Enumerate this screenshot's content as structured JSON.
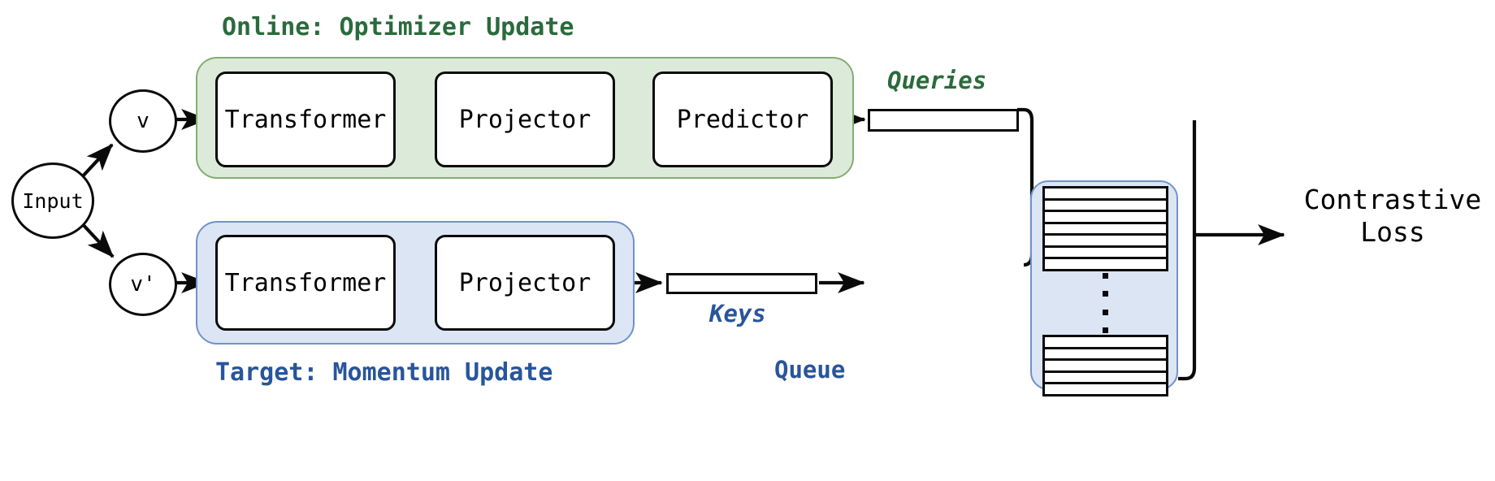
{
  "diagram": {
    "title_online": "Online: Optimizer Update",
    "title_target": "Target: Momentum Update",
    "label_queries": "Queries",
    "label_keys": "Keys",
    "label_queue": "Queue",
    "loss_line1": "Contrastive",
    "loss_line2": "Loss",
    "colors": {
      "online_fill": "#dceada",
      "online_stroke": "#84ad70",
      "online_text": "#2a6b3b",
      "target_fill": "#dce5f4",
      "target_stroke": "#7192c8",
      "target_text": "#28559b",
      "box_stroke": "#0a0a0a",
      "box_fill": "#ffffff",
      "background": "#ffffff"
    }
  },
  "nodes": {
    "input": "Input",
    "view_online": "v",
    "view_target": "v'"
  },
  "online_branch": {
    "modules": [
      {
        "label": "Transformer"
      },
      {
        "label": "Projector"
      },
      {
        "label": "Predictor"
      }
    ]
  },
  "target_branch": {
    "modules": [
      {
        "label": "Transformer"
      },
      {
        "label": "Projector"
      }
    ]
  },
  "queue": {
    "top_slots": 7,
    "bottom_slots": 5,
    "ellipsis_dots": 4
  }
}
